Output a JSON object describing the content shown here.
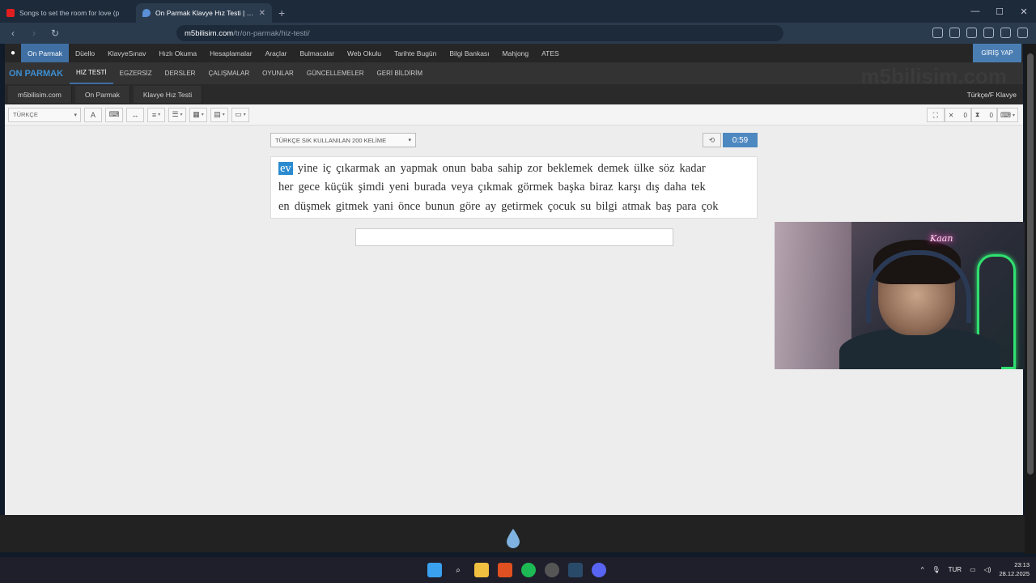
{
  "browser": {
    "tabs": [
      {
        "label": "Songs to set the room for love (p",
        "active": false,
        "icon_color": "#e02020"
      },
      {
        "label": "On Parmak Klavye Hız Testi | m5l",
        "active": true,
        "icon_color": "#5b8fd6"
      }
    ],
    "new_tab": "+",
    "url_domain": "m5bilisim.com",
    "url_path": "/tr/on-parmak/hiz-testi/",
    "brave_badge": "4",
    "alert_badge": "2"
  },
  "site": {
    "top_nav": [
      "On Parmak",
      "Düello",
      "KlavyeSınav",
      "Hızlı Okuma",
      "Hesaplamalar",
      "Araçlar",
      "Bulmacalar",
      "Web Okulu",
      "Tarihte Bugün",
      "Bilgi Bankası",
      "Mahjong",
      "ATES"
    ],
    "login": "GİRİŞ YAP",
    "brand": "ON PARMAK",
    "sub_nav": [
      "HIZ TESTİ",
      "EGZERSİZ",
      "DERSLER",
      "ÇALIŞMALAR",
      "OYUNLAR",
      "GÜNCELLEMELER",
      "GERİ BİLDİRİM"
    ],
    "watermark": "m5bilisim.com",
    "breadcrumbs": [
      "m5bilisim.com",
      "On Parmak",
      "Klavye Hız Testi"
    ],
    "keyboard_layout": "Türkçe/F Klavye",
    "language": "TÜRKÇE",
    "errors": "0",
    "time_count": "0",
    "word_set": "TÜRKÇE SIK KULLANILAN 200 KELİME",
    "timer": "0:59",
    "current_word": "ev",
    "words_line1": [
      "yine",
      "iç",
      "çıkarmak",
      "an",
      "yapmak",
      "onun",
      "baba",
      "sahip",
      "zor",
      "beklemek",
      "demek",
      "ülke",
      "söz",
      "kadar"
    ],
    "words_line2": [
      "her",
      "gece",
      "küçük",
      "şimdi",
      "yeni",
      "burada",
      "veya",
      "çıkmak",
      "görmek",
      "başka",
      "biraz",
      "karşı",
      "dış",
      "daha",
      "tek"
    ],
    "words_line3": [
      "en",
      "düşmek",
      "gitmek",
      "yani",
      "önce",
      "bunun",
      "göre",
      "ay",
      "getirmek",
      "çocuk",
      "su",
      "bilgi",
      "atmak",
      "baş",
      "para",
      "çok"
    ]
  },
  "webcam": {
    "neon_sign": "Kaan"
  },
  "taskbar": {
    "language": "TUR",
    "time": "23:13",
    "date": "28.12.2025"
  }
}
